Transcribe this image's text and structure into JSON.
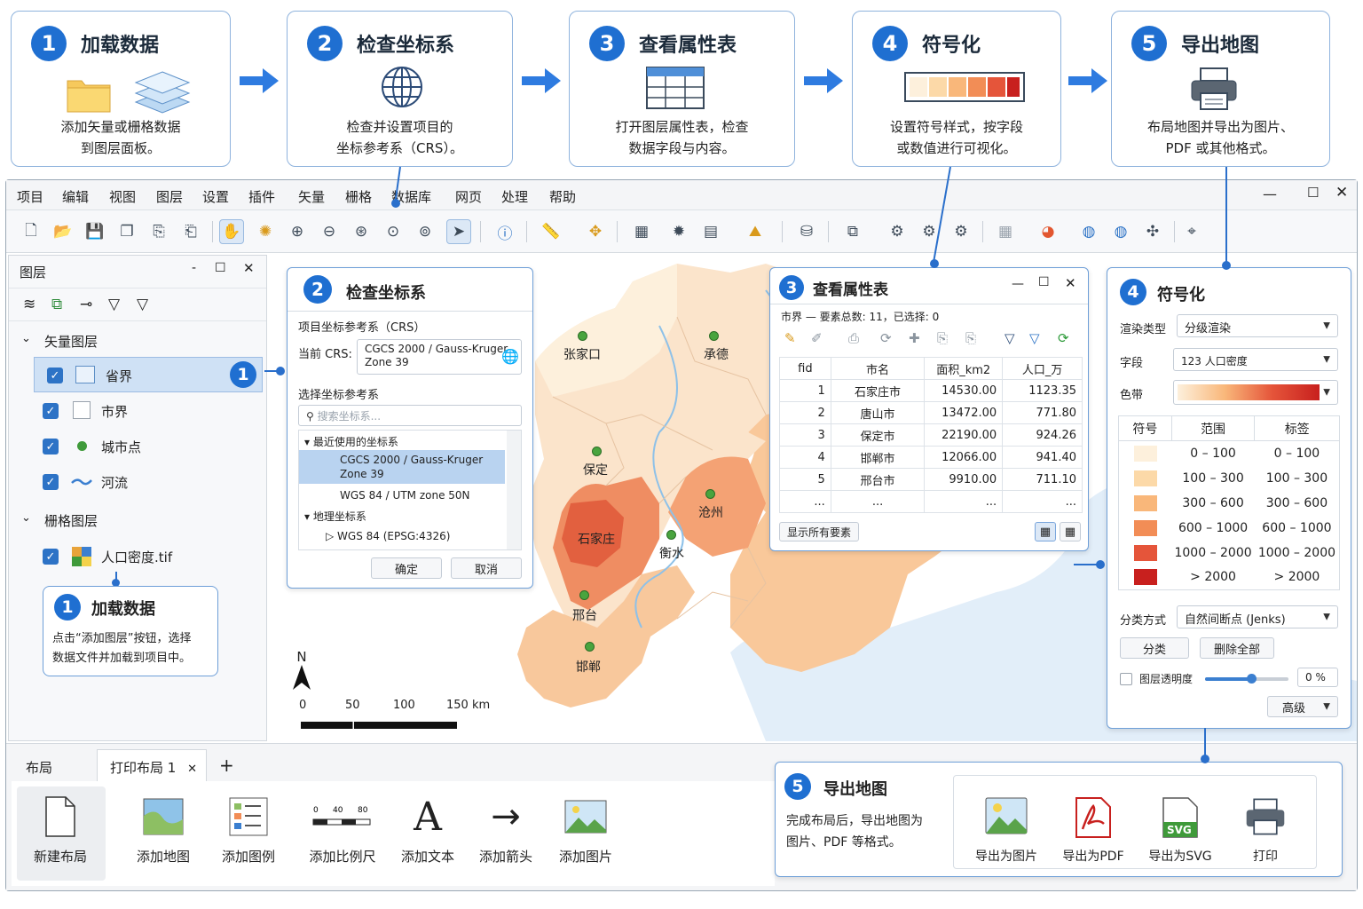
{
  "steps": [
    {
      "num": "1",
      "title": "加载数据",
      "desc1": "添加矢量或栅格数据",
      "desc2": "到图层面板。"
    },
    {
      "num": "2",
      "title": "检查坐标系",
      "desc1": "检查并设置项目的",
      "desc2": "坐标参考系（CRS）。"
    },
    {
      "num": "3",
      "title": "查看属性表",
      "desc1": "打开图层属性表，检查",
      "desc2": "数据字段与内容。"
    },
    {
      "num": "4",
      "title": "符号化",
      "desc1": "设置符号样式，按字段",
      "desc2": "或数值进行可视化。"
    },
    {
      "num": "5",
      "title": "导出地图",
      "desc1": "布局地图并导出为图片、",
      "desc2": "PDF 或其他格式。"
    }
  ],
  "menu": [
    "项目",
    "编辑",
    "视图",
    "图层",
    "设置",
    "插件",
    "矢量",
    "栅格",
    "数据库",
    "网页",
    "处理",
    "帮助"
  ],
  "layers_panel": {
    "title": "图层",
    "vector_group": "矢量图层",
    "vector_layers": [
      "省界",
      "市界",
      "城市点",
      "河流"
    ],
    "raster_group": "栅格图层",
    "raster_layers": [
      "人口密度.tif"
    ],
    "badge": "1"
  },
  "callout1": {
    "num": "1",
    "title": "加载数据",
    "line1": "点击“添加图层”按钮，选择",
    "line2": "数据文件并加载到项目中。"
  },
  "crs_panel": {
    "num": "2",
    "title": "检查坐标系",
    "project_crs_label": "项目坐标参考系（CRS）",
    "current_label": "当前 CRS:",
    "current_value_1": "CGCS 2000 / Gauss-Kruger",
    "current_value_2": "Zone 39",
    "select_label": "选择坐标参考系",
    "search_placeholder": "搜索坐标系...",
    "recent_group": "最近使用的坐标系",
    "recent_1a": "CGCS 2000 / Gauss-Kruger",
    "recent_1b": "Zone 39",
    "recent_2": "WGS 84 / UTM zone 50N",
    "geo_group": "地理坐标系",
    "geo_1": "WGS 84 (EPSG:4326)",
    "ok": "确定",
    "cancel": "取消"
  },
  "map": {
    "cities": [
      "张家口",
      "承德",
      "保定",
      "沧州",
      "石家庄",
      "衡水",
      "邢台",
      "邯郸"
    ],
    "north": "N",
    "scale": [
      "0",
      "50",
      "100",
      "150 km"
    ]
  },
  "attr_panel": {
    "num": "3",
    "title": "查看属性表",
    "summary": "市界 — 要素总数: 11，已选择: 0",
    "headers": [
      "fid",
      "市名",
      "面积_km2",
      "人口_万"
    ],
    "rows": [
      [
        "1",
        "石家庄市",
        "14530.00",
        "1123.35"
      ],
      [
        "2",
        "唐山市",
        "13472.00",
        "771.80"
      ],
      [
        "3",
        "保定市",
        "22190.00",
        "924.26"
      ],
      [
        "4",
        "邯郸市",
        "12066.00",
        "941.40"
      ],
      [
        "5",
        "邢台市",
        "9910.00",
        "711.10"
      ],
      [
        "...",
        "...",
        "...",
        "..."
      ]
    ],
    "show_all": "显示所有要素"
  },
  "sym_panel": {
    "num": "4",
    "title": "符号化",
    "render_label": "渲染类型",
    "render_value": "分级渲染",
    "field_label": "字段",
    "field_value": "123 人口密度",
    "ramp_label": "色带",
    "headers": [
      "符号",
      "范围",
      "标签"
    ],
    "classes": [
      {
        "range": "0 – 100",
        "label": "0 – 100",
        "color": "#fdf0dc"
      },
      {
        "range": "100 – 300",
        "label": "100 – 300",
        "color": "#fcd9a8"
      },
      {
        "range": "300 – 600",
        "label": "300 – 600",
        "color": "#f9b77a"
      },
      {
        "range": "600 – 1000",
        "label": "600 – 1000",
        "color": "#f28d56"
      },
      {
        "range": "1000 – 2000",
        "label": "1000 – 2000",
        "color": "#e5553a"
      },
      {
        "range": "> 2000",
        "label": "> 2000",
        "color": "#c8201e"
      }
    ],
    "method_label": "分类方式",
    "method_value": "自然间断点 (Jenks)",
    "classify": "分类",
    "delete_all": "删除全部",
    "opacity_label": "图层透明度",
    "opacity_value": "0 %",
    "advanced": "高级"
  },
  "layout": {
    "tab_label": "布局",
    "print_tab": "打印布局 1",
    "tools": [
      "新建布局",
      "添加地图",
      "添加图例",
      "添加比例尺",
      "添加文本",
      "添加箭头",
      "添加图片"
    ]
  },
  "export_panel": {
    "num": "5",
    "title": "导出地图",
    "line1": "完成布局后，导出地图为",
    "line2": "图片、PDF 等格式。",
    "buttons": [
      "导出为图片",
      "导出为PDF",
      "导出为SVG",
      "打印"
    ]
  },
  "colors": {
    "accent": "#1f6fd1",
    "border": "#8fb3dd"
  }
}
